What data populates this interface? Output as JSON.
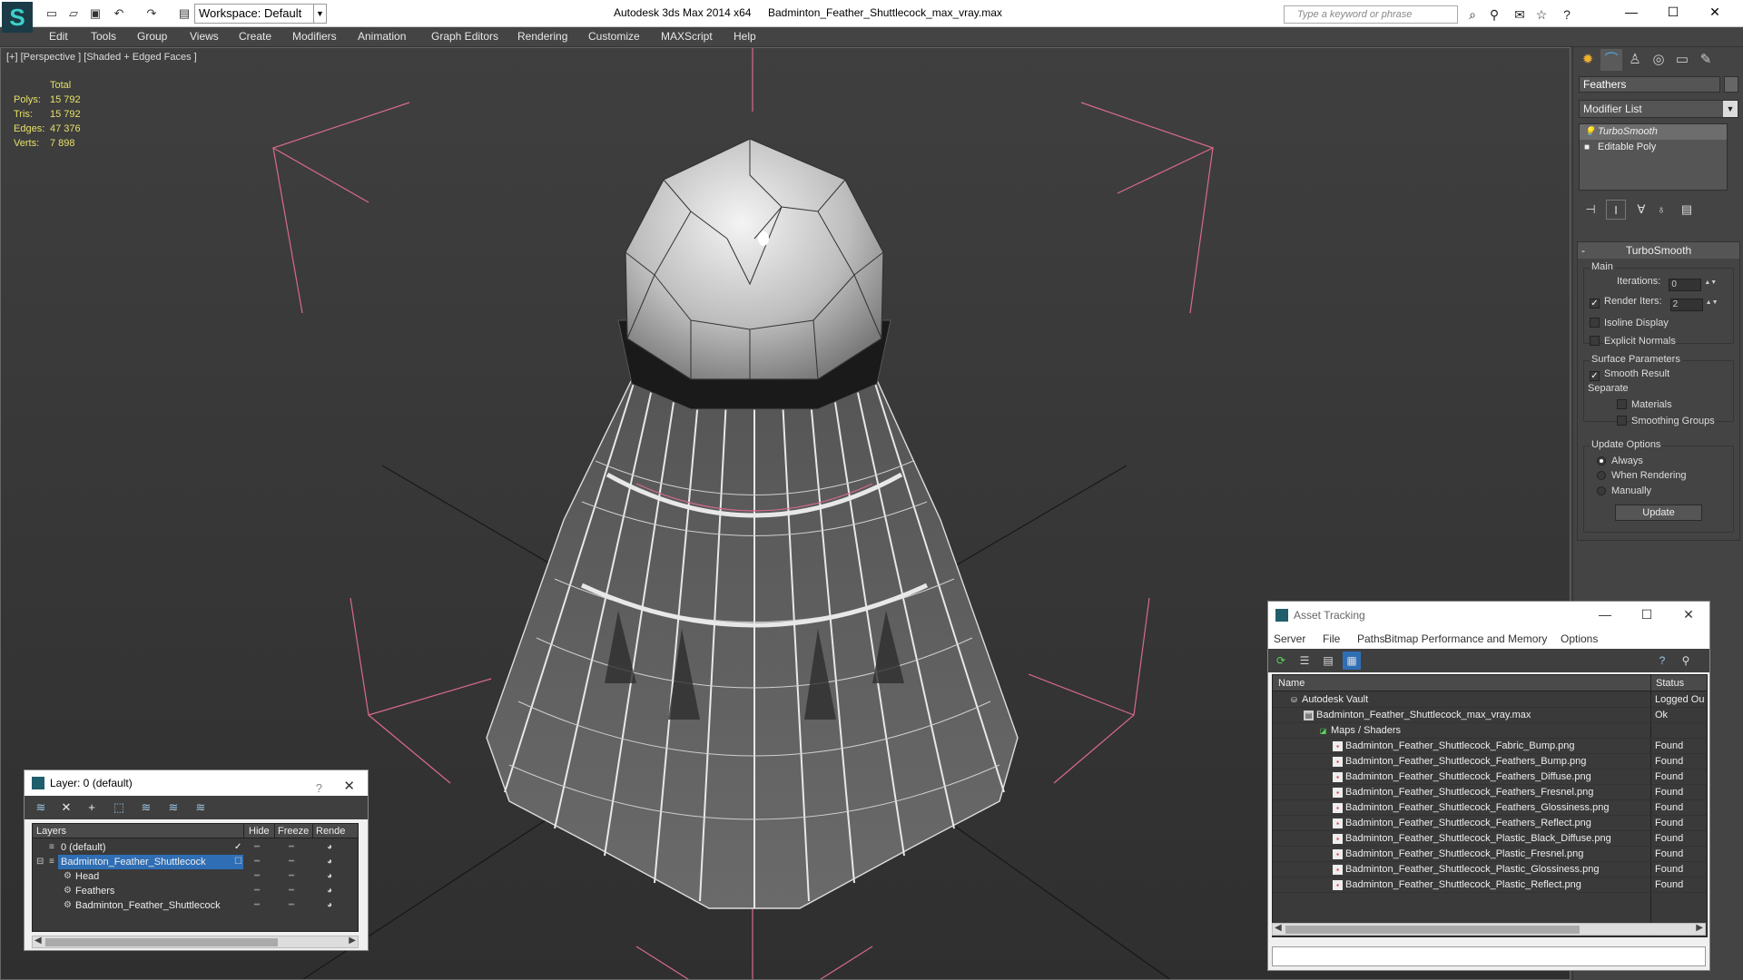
{
  "titlebar": {
    "app": "Autodesk 3ds Max  2014 x64",
    "file": "Badminton_Feather_Shuttlecock_max_vray.max",
    "workspace": "Workspace: Default",
    "search_placeholder": "Type a keyword or phrase",
    "window_buttons": [
      "—",
      "☐",
      "✕"
    ]
  },
  "menu": [
    "Edit",
    "Tools",
    "Group",
    "Views",
    "Create",
    "Modifiers",
    "Animation",
    "Graph Editors",
    "Rendering",
    "Customize",
    "MAXScript",
    "Help"
  ],
  "viewport": {
    "label": "[+] [Perspective ] [Shaded + Edged Faces ]",
    "stats": {
      "header": "Total",
      "rows": [
        {
          "label": "Polys:",
          "value": "15 792"
        },
        {
          "label": "Tris:",
          "value": "15 792"
        },
        {
          "label": "Edges:",
          "value": "47 376"
        },
        {
          "label": "Verts:",
          "value": "7 898"
        }
      ]
    }
  },
  "command_panel": {
    "object_name": "Feathers",
    "modifier_list": "Modifier List",
    "stack": [
      {
        "label": "TurboSmooth",
        "active": true
      },
      {
        "label": "Editable Poly",
        "active": false
      }
    ],
    "rollout": {
      "title": "TurboSmooth",
      "main_group": "Main",
      "iterations_label": "Iterations:",
      "iterations_value": "0",
      "render_iters_label": "Render Iters:",
      "render_iters_value": "2",
      "render_iters_checked": true,
      "isoline": "Isoline Display",
      "explicit_normals": "Explicit Normals",
      "surface_group": "Surface Parameters",
      "smooth_result": "Smooth Result",
      "separate": "Separate",
      "materials": "Materials",
      "smoothing_groups": "Smoothing Groups",
      "update_group": "Update Options",
      "always": "Always",
      "when_rendering": "When Rendering",
      "manually": "Manually",
      "update_button": "Update"
    }
  },
  "layer_window": {
    "title": "Layer: 0 (default)",
    "help": "?",
    "close": "✕",
    "columns": [
      "Layers",
      "Hide",
      "Freeze",
      "Rende"
    ],
    "rows": [
      {
        "name": "0 (default)",
        "indent": 0,
        "selected": false
      },
      {
        "name": "Badminton_Feather_Shuttlecock",
        "indent": 0,
        "selected": true
      },
      {
        "name": "Head",
        "indent": 1,
        "selected": false
      },
      {
        "name": "Feathers",
        "indent": 1,
        "selected": false
      },
      {
        "name": "Badminton_Feather_Shuttlecock",
        "indent": 1,
        "selected": false
      }
    ]
  },
  "asset_window": {
    "title": "Asset Tracking",
    "menu": [
      "Server",
      "File",
      "Paths",
      "Bitmap Performance and Memory",
      "Options"
    ],
    "columns": [
      "Name",
      "Status"
    ],
    "rows": [
      {
        "name": "Autodesk Vault",
        "status": "Logged Ou",
        "indent": 1,
        "kind": "vault"
      },
      {
        "name": "Badminton_Feather_Shuttlecock_max_vray.max",
        "status": "Ok",
        "indent": 2,
        "kind": "file"
      },
      {
        "name": "Maps / Shaders",
        "status": "",
        "indent": 3,
        "kind": "folder"
      },
      {
        "name": "Badminton_Feather_Shuttlecock_Fabric_Bump.png",
        "status": "Found",
        "indent": 4,
        "kind": "png"
      },
      {
        "name": "Badminton_Feather_Shuttlecock_Feathers_Bump.png",
        "status": "Found",
        "indent": 4,
        "kind": "png"
      },
      {
        "name": "Badminton_Feather_Shuttlecock_Feathers_Diffuse.png",
        "status": "Found",
        "indent": 4,
        "kind": "png"
      },
      {
        "name": "Badminton_Feather_Shuttlecock_Feathers_Fresnel.png",
        "status": "Found",
        "indent": 4,
        "kind": "png"
      },
      {
        "name": "Badminton_Feather_Shuttlecock_Feathers_Glossiness.png",
        "status": "Found",
        "indent": 4,
        "kind": "png"
      },
      {
        "name": "Badminton_Feather_Shuttlecock_Feathers_Reflect.png",
        "status": "Found",
        "indent": 4,
        "kind": "png"
      },
      {
        "name": "Badminton_Feather_Shuttlecock_Plastic_Black_Diffuse.png",
        "status": "Found",
        "indent": 4,
        "kind": "png"
      },
      {
        "name": "Badminton_Feather_Shuttlecock_Plastic_Fresnel.png",
        "status": "Found",
        "indent": 4,
        "kind": "png"
      },
      {
        "name": "Badminton_Feather_Shuttlecock_Plastic_Glossiness.png",
        "status": "Found",
        "indent": 4,
        "kind": "png"
      },
      {
        "name": "Badminton_Feather_Shuttlecock_Plastic_Reflect.png",
        "status": "Found",
        "indent": 4,
        "kind": "png"
      }
    ]
  },
  "colors": {
    "stats_yellow": "#e6e06a",
    "selection_blue": "#2f6eb5",
    "bbox_pink": "#d86a8a"
  }
}
